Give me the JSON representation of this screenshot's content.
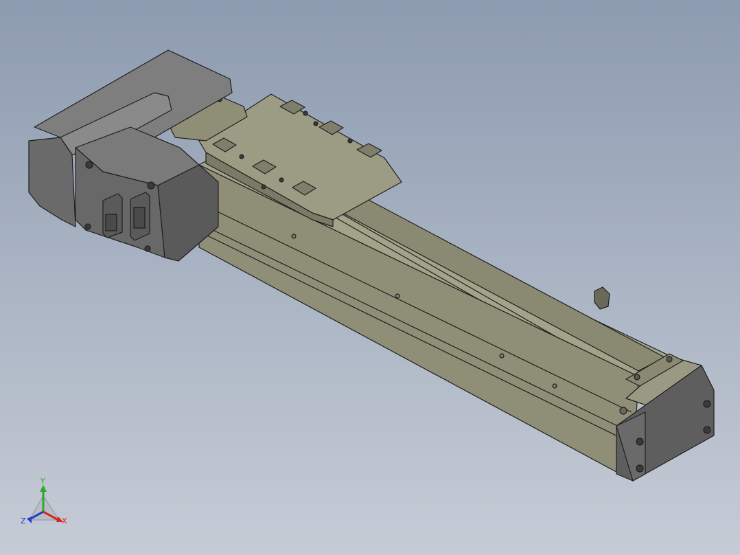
{
  "viewport": {
    "background_top": "#8d9bb0",
    "background_bottom": "#c6ccd6"
  },
  "model": {
    "body_color": "#8f8f78",
    "edge_color": "#1e1e1e",
    "motor_color": "#6e6e6e"
  },
  "triad": {
    "x_label": "X",
    "y_label": "Y",
    "z_label": "Z",
    "x_color": "#d8241f",
    "y_color": "#2ea82e",
    "z_color": "#2340c8"
  }
}
